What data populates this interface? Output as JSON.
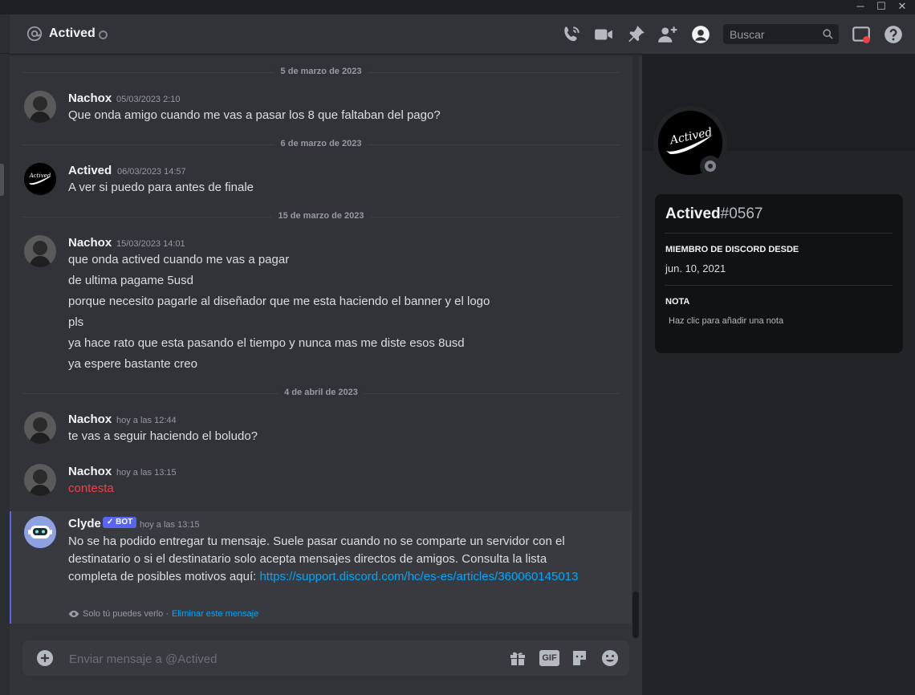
{
  "window": {
    "minimize": "─",
    "maximize": "☐",
    "close": "✕"
  },
  "header": {
    "channel_name": "Actived",
    "search_placeholder": "Buscar",
    "icons": [
      "call-icon",
      "video-call-icon",
      "pin-icon",
      "add-friend-icon",
      "user-profile-icon",
      "search-icon",
      "inbox-icon",
      "help-icon"
    ]
  },
  "messages": {
    "dividers": [
      "5 de marzo de 2023",
      "6 de marzo de 2023",
      "15 de marzo de 2023",
      "4 de abril de 2023"
    ],
    "m1": {
      "author": "Nachox",
      "time": "05/03/2023 2:10",
      "lines": [
        "Que onda amigo cuando me vas a pasar los 8 que faltaban del pago?"
      ]
    },
    "m2": {
      "author": "Actived",
      "time": "06/03/2023 14:57",
      "lines": [
        "A ver si puedo para antes de finale"
      ]
    },
    "m3": {
      "author": "Nachox",
      "time": "15/03/2023 14:01",
      "lines": [
        "que onda actived cuando me vas a pagar",
        "de ultima pagame 5usd",
        "porque necesito pagarle al diseñador que me esta haciendo el banner y el logo",
        "pls",
        "ya hace rato que esta pasando el tiempo y nunca mas me diste esos 8usd",
        "ya espere bastante creo"
      ]
    },
    "m4": {
      "author": "Nachox",
      "time": "hoy a las 12:44",
      "lines": [
        "te vas a seguir haciendo el boludo?"
      ]
    },
    "m5": {
      "author": "Nachox",
      "time": "hoy a las 13:15",
      "lines": [
        "contesta"
      ]
    },
    "clyde": {
      "author": "Clyde",
      "badge": "✓ BOT",
      "time": "hoy a las 13:15",
      "text": "No se ha podido entregar tu mensaje. Suele pasar cuando no se comparte un servidor con el destinatario o si el destinatario solo acepta mensajes directos de amigos. Consulta la lista completa de posibles motivos aquí: ",
      "link": "https://support.discord.com/hc/es-es/articles/360060145013",
      "only_you": "Solo tú puedes verlo ·",
      "delete": "Eliminar este mensaje"
    }
  },
  "composer": {
    "placeholder": "Enviar mensaje a @Actived",
    "gif_label": "GIF",
    "icons": [
      "add-attachment-icon",
      "gift-icon",
      "gif-icon",
      "sticker-icon",
      "emoji-icon"
    ]
  },
  "profile": {
    "username": "Actived",
    "discriminator": "#0567",
    "avatar_text": "Actived",
    "member_since_label": "MIEMBRO DE DISCORD DESDE",
    "member_since": "jun. 10, 2021",
    "note_label": "NOTA",
    "note_placeholder": "Haz clic para añadir una nota"
  },
  "colors": {
    "accent": "#5865f2",
    "link": "#00a8fc",
    "danger": "#f23f43",
    "status_offline": "#80848e"
  }
}
